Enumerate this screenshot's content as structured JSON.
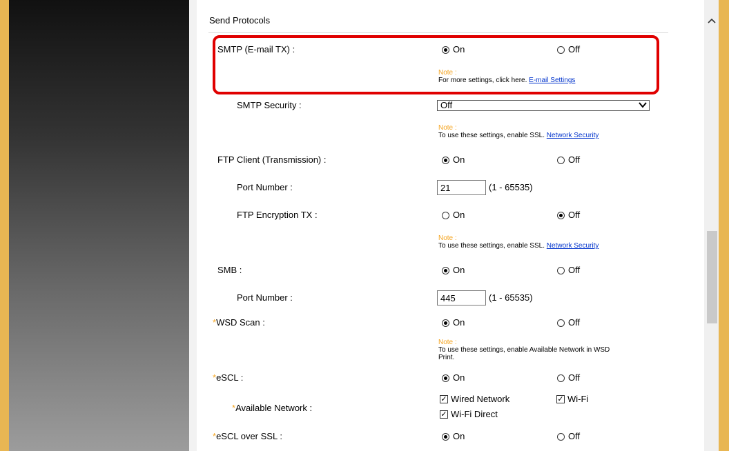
{
  "section_title": "Send Protocols",
  "radio_on": "On",
  "radio_off": "Off",
  "note_title": "Note :",
  "range": "(1 - 65535)",
  "smtp": {
    "label": "SMTP (E-mail TX) :",
    "value": "On",
    "note_text": "For more settings, click here.",
    "note_link": "E-mail Settings"
  },
  "smtp_security": {
    "label": "SMTP Security :",
    "value": "Off",
    "note_text": "To use these settings, enable SSL.",
    "note_link": "Network Security"
  },
  "ftp_client": {
    "label": "FTP Client (Transmission) :",
    "value": "On"
  },
  "ftp_port": {
    "label": "Port Number :",
    "value": "21"
  },
  "ftp_encryption": {
    "label": "FTP Encryption TX :",
    "value": "Off",
    "note_text": "To use these settings, enable SSL.",
    "note_link": "Network Security"
  },
  "smb": {
    "label": "SMB :",
    "value": "On"
  },
  "smb_port": {
    "label": "Port Number :",
    "value": "445"
  },
  "wsd_scan": {
    "star": "*",
    "label": "WSD Scan :",
    "value": "On",
    "note_line1": "To use these settings, enable Available Network in WSD",
    "note_line2": "Print."
  },
  "escl": {
    "star": "*",
    "label": "eSCL :",
    "value": "On"
  },
  "available_network": {
    "star": "*",
    "label": "Available Network :",
    "options": [
      {
        "label": "Wired Network",
        "checked": true
      },
      {
        "label": "Wi-Fi",
        "checked": true
      },
      {
        "label": "Wi-Fi Direct",
        "checked": true
      }
    ]
  },
  "escl_ssl": {
    "star": "*",
    "label": "eSCL over SSL :",
    "value": "On"
  },
  "colors": {
    "frame": "#e8b653",
    "note": "#f5a623",
    "link": "#0033cc",
    "highlight": "#e00000"
  },
  "icons": {
    "scroll_up": "chevron-up-icon",
    "dropdown": "chevron-down-icon",
    "check": "checkmark-icon"
  }
}
